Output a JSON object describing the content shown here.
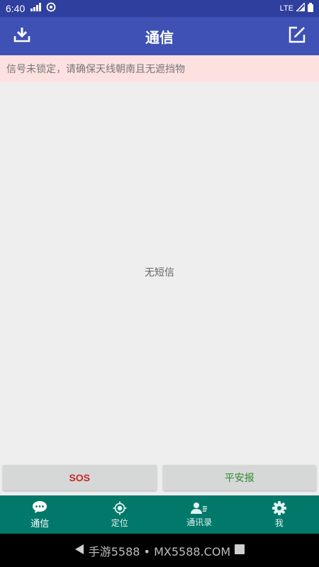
{
  "status_bar": {
    "time": "6:40",
    "network": "LTE",
    "icons": [
      "signal-icon",
      "sync-icon",
      "cell-signal-icon",
      "battery-icon"
    ]
  },
  "app_bar": {
    "title": "通信",
    "left_icon": "download-icon",
    "right_icon": "compose-icon"
  },
  "warning": {
    "text": "信号未锁定，请确保天线朝南且无遮挡物"
  },
  "content": {
    "empty_text": "无短信"
  },
  "actions": {
    "sos_label": "SOS",
    "safe_label": "平安报",
    "sos_color": "#c62828",
    "safe_color": "#2e8b2e"
  },
  "bottom_nav": {
    "items": [
      {
        "label": "通信",
        "icon": "chat-icon",
        "active": true
      },
      {
        "label": "定位",
        "icon": "location-icon",
        "active": false
      },
      {
        "label": "通讯录",
        "icon": "contacts-icon",
        "active": false
      },
      {
        "label": "我",
        "icon": "gear-icon",
        "active": false
      }
    ]
  },
  "system_nav": {
    "watermark": "手游5588 • MX5588.COM"
  },
  "colors": {
    "status_bar": "#2f3f9e",
    "app_bar": "#3f51b5",
    "warning_bg": "#fde0e0",
    "bottom_nav": "#00796b"
  }
}
